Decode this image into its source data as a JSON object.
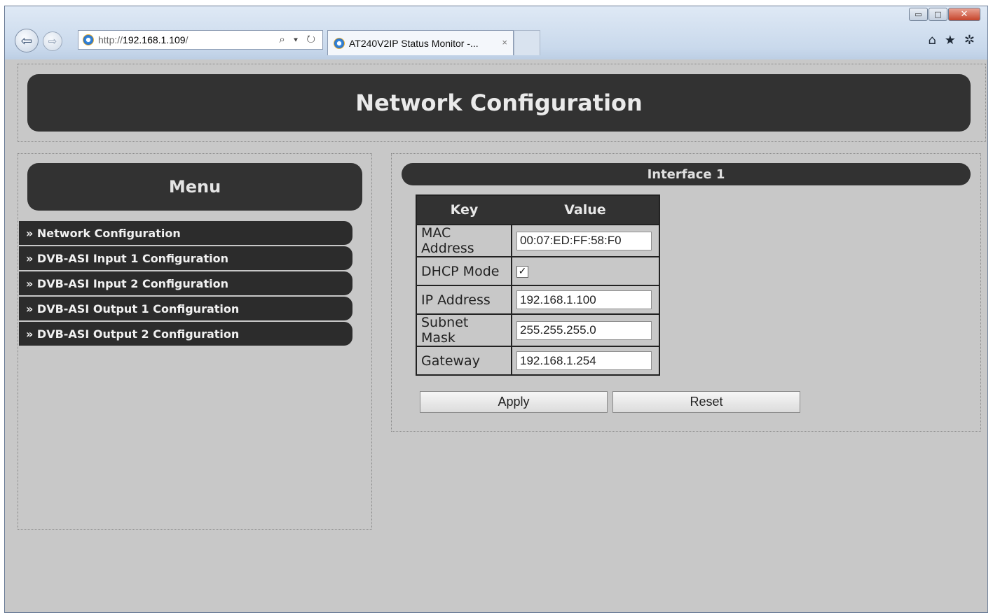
{
  "browser": {
    "address_protocol": "http://",
    "address_host": "192.168.1.109",
    "address_suffix": "/",
    "tab_title": "AT240V2IP Status Monitor -...",
    "tab_close": "×",
    "address_tools": "⌕ ▾ ↻",
    "window_buttons": {
      "minimize": "▭",
      "maximize": "□",
      "close": "✕"
    },
    "tool_icons": {
      "home": "⌂",
      "favorites": "★",
      "settings": "✲"
    },
    "back_icon": "⇦",
    "forward_icon": "⇨"
  },
  "page": {
    "title": "Network Configuration",
    "menu_title": "Menu",
    "menu_items": [
      "» Network Configuration",
      "» DVB-ASI Input 1 Configuration",
      "» DVB-ASI Input 2 Configuration",
      "» DVB-ASI Output 1 Configuration",
      "» DVB-ASI Output 2 Configuration"
    ],
    "interface_title": "Interface 1",
    "table": {
      "header_key": "Key",
      "header_value": "Value",
      "rows": [
        {
          "key": "MAC Address",
          "value": "00:07:ED:FF:58:F0"
        },
        {
          "key": "DHCP Mode",
          "value": "✓"
        },
        {
          "key": "IP Address",
          "value": "192.168.1.100"
        },
        {
          "key": "Subnet Mask",
          "value": "255.255.255.0"
        },
        {
          "key": "Gateway",
          "value": "192.168.1.254"
        }
      ]
    },
    "apply_label": "Apply",
    "reset_label": "Reset"
  },
  "colors": {
    "bar_dark": "#323232",
    "page_bg": "#c8c8c8",
    "chrome_blue": "#c9d9ec"
  }
}
